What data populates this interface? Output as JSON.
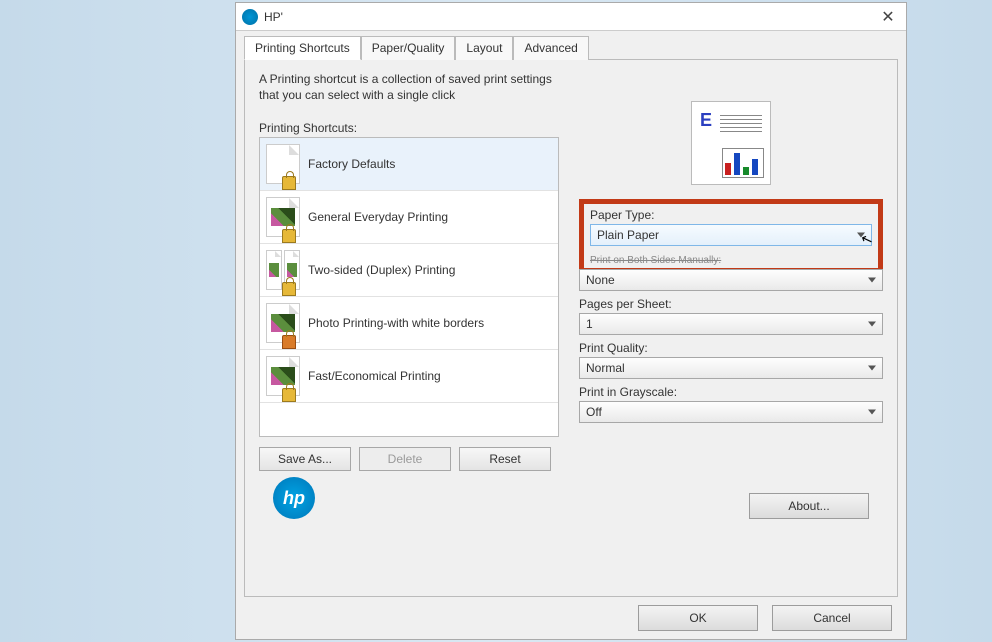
{
  "window": {
    "title": "HP'"
  },
  "tabs": [
    {
      "label": "Printing Shortcuts"
    },
    {
      "label": "Paper/Quality"
    },
    {
      "label": "Layout"
    },
    {
      "label": "Advanced"
    }
  ],
  "intro": "A Printing shortcut is a collection of saved print settings that you can select with a single click",
  "shortcuts": {
    "heading": "Printing Shortcuts:",
    "items": [
      {
        "label": "Factory Defaults"
      },
      {
        "label": "General Everyday Printing"
      },
      {
        "label": "Two-sided (Duplex) Printing"
      },
      {
        "label": "Photo Printing-with white borders"
      },
      {
        "label": "Fast/Economical Printing"
      }
    ]
  },
  "buttons": {
    "saveas": "Save As...",
    "delete": "Delete",
    "reset": "Reset",
    "about": "About...",
    "ok": "OK",
    "cancel": "Cancel"
  },
  "settings": {
    "paper_type": {
      "label": "Paper Type:",
      "value": "Plain Paper"
    },
    "both_sides": {
      "label": "Print on Both Sides Manually:",
      "value": "None"
    },
    "pages_per_sheet": {
      "label": "Pages per Sheet:",
      "value": "1"
    },
    "print_quality": {
      "label": "Print Quality:",
      "value": "Normal"
    },
    "grayscale": {
      "label": "Print in Grayscale:",
      "value": "Off"
    }
  },
  "preview_letter": "E"
}
